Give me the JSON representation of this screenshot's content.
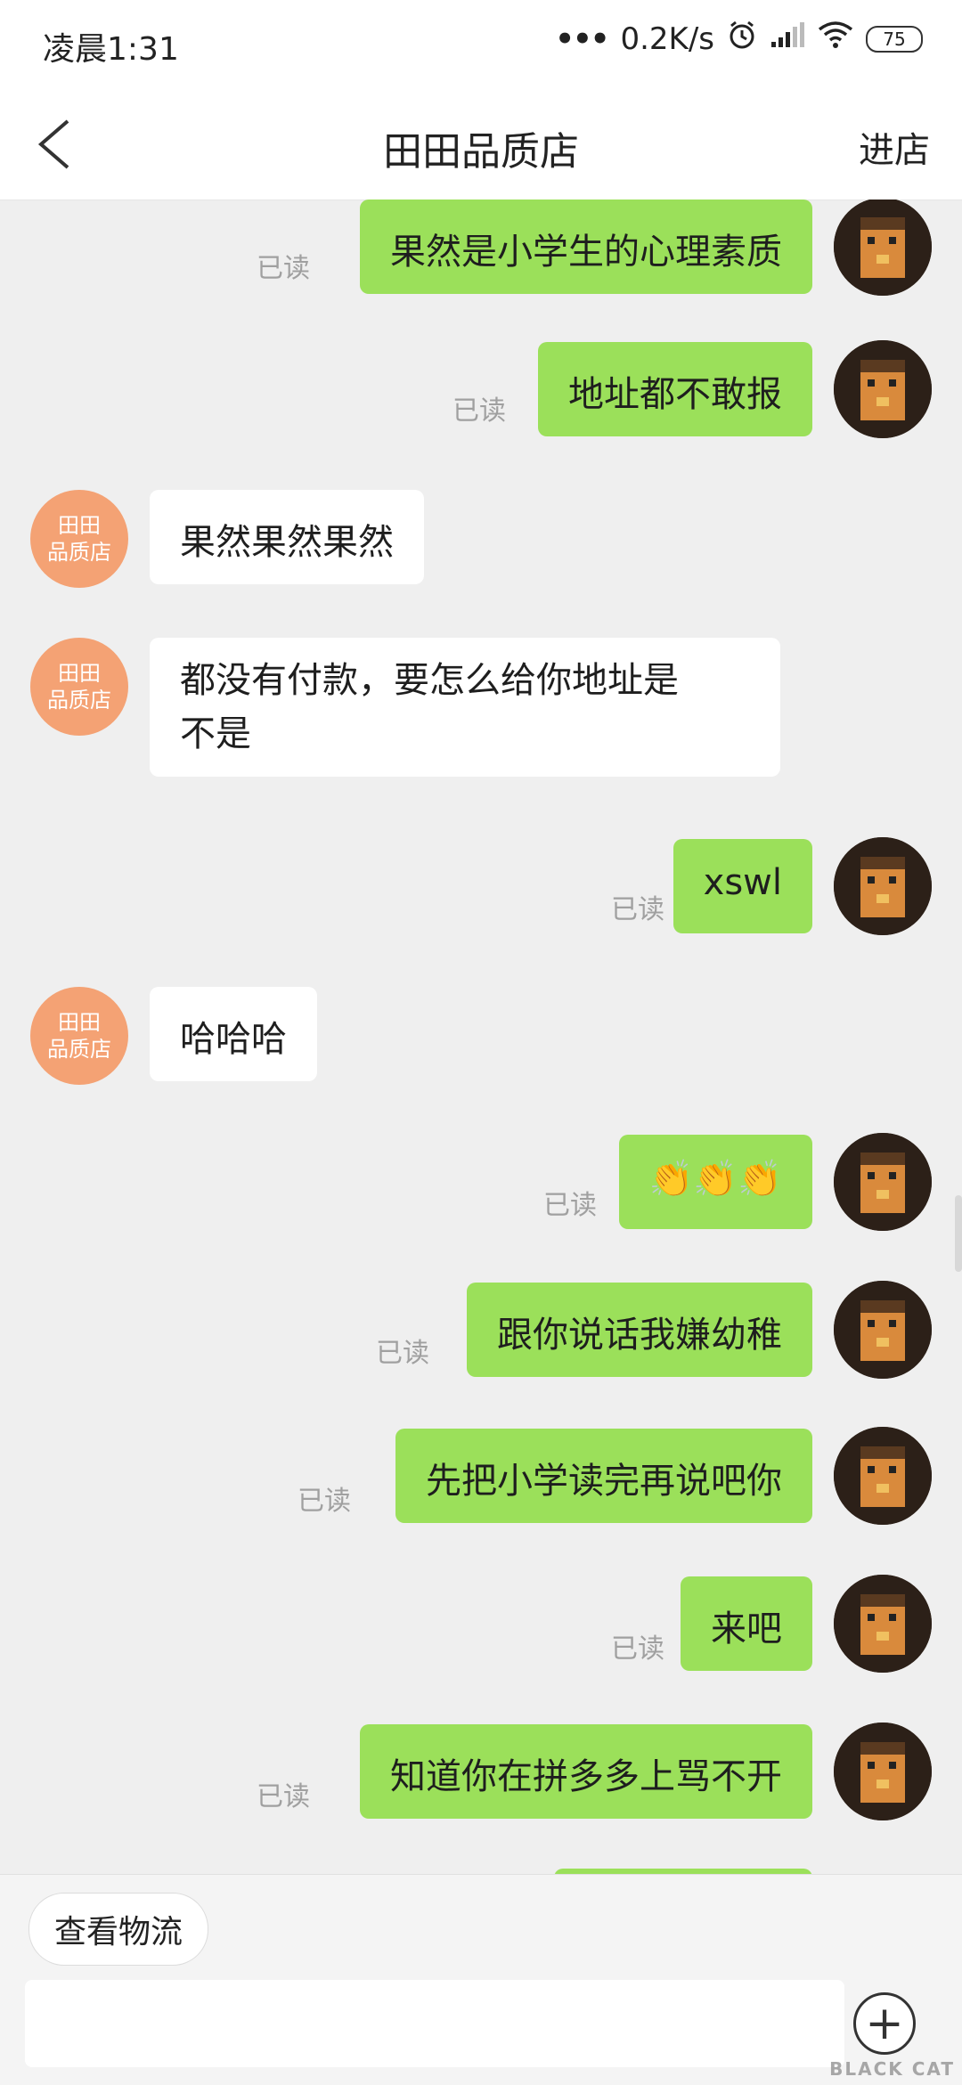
{
  "status_bar": {
    "time": "凌晨1:31",
    "speed": "0.2K/s",
    "battery": "75"
  },
  "header": {
    "title": "田田品质店",
    "action": "进店"
  },
  "messages": [
    {
      "from": "me",
      "text": "果然是小学生的心理素质",
      "read": "已读"
    },
    {
      "from": "me",
      "text": "地址都不敢报",
      "read": "已读"
    },
    {
      "from": "shop",
      "text": "果然果然果然",
      "avatar_line1": "田田",
      "avatar_line2": "品质店"
    },
    {
      "from": "shop",
      "text_line1": "都没有付款，要怎么给你地址是",
      "text_line2": "不是",
      "avatar_line1": "田田",
      "avatar_line2": "品质店"
    },
    {
      "from": "me",
      "text": "xswl",
      "read": "已读"
    },
    {
      "from": "shop",
      "text": "哈哈哈",
      "avatar_line1": "田田",
      "avatar_line2": "品质店"
    },
    {
      "from": "me",
      "text": "👏👏👏",
      "read": "已读"
    },
    {
      "from": "me",
      "text": "跟你说话我嫌幼稚",
      "read": "已读"
    },
    {
      "from": "me",
      "text": "先把小学读完再说吧你",
      "read": "已读"
    },
    {
      "from": "me",
      "text": "来吧",
      "read": "已读"
    },
    {
      "from": "me",
      "text": "知道你在拼多多上骂不开",
      "read": "已读"
    }
  ],
  "bottom": {
    "logistics_label": "查看物流",
    "input_placeholder": ""
  },
  "watermark": "BLACK CAT"
}
